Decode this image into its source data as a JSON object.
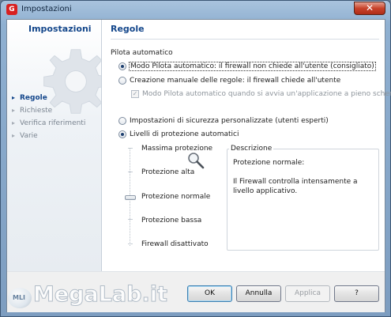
{
  "window": {
    "title": "Impostazioni",
    "close_glyph": "✕"
  },
  "sidebar": {
    "title": "Impostazioni",
    "items": [
      {
        "label": "Regole",
        "active": true
      },
      {
        "label": "Richieste",
        "active": false
      },
      {
        "label": "Verifica riferimenti",
        "active": false
      },
      {
        "label": "Varie",
        "active": false
      }
    ]
  },
  "page": {
    "title": "Regole",
    "group_label": "Pilota automatico",
    "options": {
      "auto_pilot": "Modo Pilota automatico: il firewall non chiede all'utente (consigliato)",
      "manual_rules": "Creazione manuale delle regole: il firewall chiede all'utente",
      "auto_pilot_fullscreen": "Modo Pilota automatico quando si avvia un'applicazione a pieno scher",
      "custom_settings": "Impostazioni di sicurezza personalizzate (utenti esperti)",
      "auto_levels": "Livelli di protezione automatici"
    },
    "selected_option": "auto_pilot",
    "selected_mode": "auto_levels"
  },
  "levels": {
    "labels": [
      "Massima protezione",
      "Protezione alta",
      "Protezione normale",
      "Protezione bassa",
      "Firewall disattivato"
    ],
    "selected": "Protezione normale"
  },
  "description": {
    "legend": "Descrizione",
    "heading": "Protezione normale:",
    "body": "Il Firewall controlla intensamente a livello applicativo."
  },
  "buttons": {
    "ok": "OK",
    "cancel": "Annulla",
    "apply": "Applica",
    "help": "?"
  },
  "watermark": {
    "text": "MegaLab.it",
    "badge": "MLI"
  }
}
